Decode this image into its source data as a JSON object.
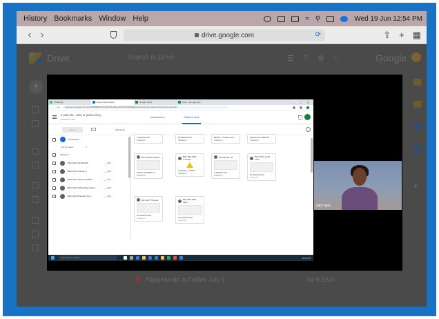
{
  "menubar": {
    "items": [
      "History",
      "Bookmarks",
      "Window",
      "Help"
    ],
    "datetime": "Wed 19 Jun  12:54 PM"
  },
  "toolbar": {
    "url": "drive.google.com",
    "back_icon": "chevron-left-icon",
    "forward_icon": "chevron-right-icon"
  },
  "drive_bg": {
    "app_name": "Drive",
    "search_placeholder": "Search in Drive",
    "brand": "Google",
    "bottom_item": "Playgrounds at Fallbrk July 9",
    "bottom_date": "Jul 9 2024"
  },
  "shared_screen": {
    "tabs": [
      {
        "label": "WhatsApp",
        "color": "#25d366"
      },
      {
        "label": "Record Submission",
        "color": "#1967d2"
      },
      {
        "label": "Google Sheet",
        "color": "#188038"
      },
      {
        "label": "Meet - kcm-gpp-huv",
        "color": "#00897b"
      }
    ],
    "address": "classroom.google.com/u/1/c/MTM5MTc0OTg3NTc4/a/MjcxOTk3NTM1MDg2/submissions/by-status/and-sort-first-name/all",
    "class_title": "II CBZ KM - SEM IV (2020-2021)",
    "class_sub": "ZOOLOGY KM",
    "tab_instructions": "Instructions",
    "tab_student_work": "Student work",
    "return_button": "Return",
    "points": "100 points",
    "all_students": "All students",
    "sort_by": "Sort by status",
    "section_turned_in": "Turned in",
    "students": [
      {
        "name": "BZC 2012 Sai Mahidhi",
        "score": "___/100"
      },
      {
        "name": "BZC 2013 Vineela Lj",
        "score": "___/100"
      },
      {
        "name": "BZC 2014 J.Surya Prabha",
        "score": "___/100"
      },
      {
        "name": "BZC 2022 Vithala Raj Lakshm...",
        "score": "___/100"
      },
      {
        "name": "BZC 2021 B.Naresh Kum...",
        "score": "___/100"
      }
    ],
    "cards": [
      {
        "name": "",
        "meta": "3 attachments",
        "status": "Turned in"
      },
      {
        "name": "",
        "meta": "20 attachments",
        "status": "Turned in"
      },
      {
        "name": "",
        "meta": "BZC12 Y Sorale work...",
        "status": "Turned in"
      },
      {
        "name": "",
        "meta": "Kethamma ci BZC B...",
        "status": "Turned in"
      },
      {
        "name": "Bzc 2k 2014 Shyam",
        "meta": "Pritham 8 D40 B Yo...",
        "status": "Turned in"
      },
      {
        "name": "BZC 894 2019 V.Thisan",
        "meta": "V.Harsen_1 MHITI...",
        "status": "Turned in"
      },
      {
        "name": "Sivaramara 1st",
        "meta": "2 attachments",
        "status": "Turned in"
      },
      {
        "name": "BZC 2020 Jyothi Latih",
        "meta": "No attachments",
        "status": "Assigned"
      },
      {
        "name": "Bzc 2007 Thumati",
        "meta": "No attachments",
        "status": "Assigned"
      },
      {
        "name": "BZC 894 2019 Marri...",
        "meta": "No attachments",
        "status": "Assigned"
      }
    ],
    "taskbar_search": "Type here to search",
    "tray_time": "12:54 PM"
  },
  "participant": {
    "name": "sant rupa"
  },
  "colors": {
    "frame_blue": "#1a72c4",
    "menubar": "#b9a7ac",
    "classroom_blue": "#1967d2",
    "turned_in_green": "#188038"
  }
}
